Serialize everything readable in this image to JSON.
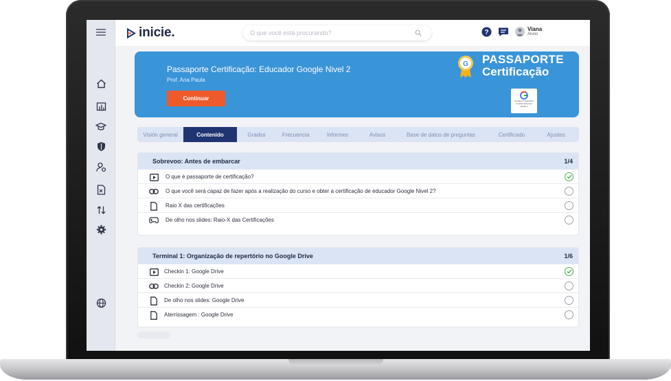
{
  "header": {
    "logo_text": "inicie.",
    "search_placeholder": "O que você está procurando?",
    "user_name": "Viana",
    "user_role": "Aluno"
  },
  "sidebar": {
    "icons": [
      "menu-icon",
      "home-icon",
      "dashboard-icon",
      "graduation-cap-icon",
      "shield-icon",
      "user-settings-icon",
      "file-excel-icon",
      "sort-arrows-icon",
      "gear-icon",
      "globe-icon"
    ]
  },
  "banner": {
    "title": "Passaporte Certificação: Educador Google Nivel 2",
    "professor": "Prof. Ana Paula",
    "continue_label": "Continuar",
    "passport_line1": "PASSAPORTE",
    "passport_line2": "Certificação",
    "cert_card_text": "Google for Education Certified Educator",
    "cert_card_level": "LEVEL 2"
  },
  "tabs": [
    {
      "label": "Visión general",
      "active": false
    },
    {
      "label": "Contenido",
      "active": true
    },
    {
      "label": "Grados",
      "active": false
    },
    {
      "label": "Frecuencia",
      "active": false
    },
    {
      "label": "Informes",
      "active": false
    },
    {
      "label": "Avisos",
      "active": false
    },
    {
      "label": "Base de datos de preguntas",
      "active": false
    },
    {
      "label": "Certificado",
      "active": false
    },
    {
      "label": "Ajustes",
      "active": false
    }
  ],
  "sections": [
    {
      "title": "Sobrevoo: Antes de embarcar",
      "count": "1/4",
      "items": [
        {
          "label": "O que é passaporte de certificação?",
          "icon": "video-play-icon",
          "done": true
        },
        {
          "label": "O que você será capaz de fazer após a realização do curso e obter a certificação de educador Google Nivel 2?",
          "icon": "link-icon",
          "done": false
        },
        {
          "label": "Raio X das certificações",
          "icon": "document-icon",
          "done": false
        },
        {
          "label": "De olho nos slides: Raio-X das Certificações",
          "icon": "gamepad-icon",
          "done": false
        }
      ]
    },
    {
      "title": "Terminal 1: Organização de repertório no Google Drive",
      "count": "1/6",
      "items": [
        {
          "label": "Checkin 1: Google Drive",
          "icon": "video-play-icon",
          "done": true
        },
        {
          "label": "Checkin 2: Google Drive",
          "icon": "link-icon",
          "done": false
        },
        {
          "label": "De olho nos slides: Google Drive",
          "icon": "document-icon",
          "done": false
        },
        {
          "label": "Aterrissagem : Google Drive",
          "icon": "document-icon",
          "done": false
        }
      ]
    }
  ],
  "colors": {
    "banner": "#3a94d8",
    "accent_button": "#ee5a2a",
    "active_tab": "#1f3470",
    "tab_bar": "#dbe4f5",
    "done": "#4cae4f"
  }
}
